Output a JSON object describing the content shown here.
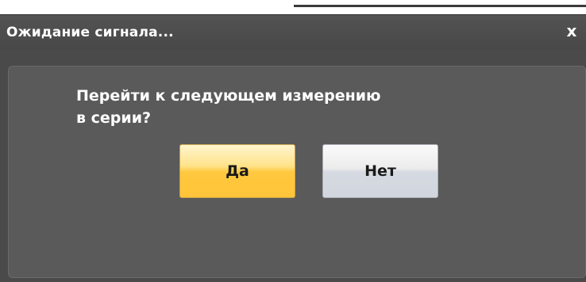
{
  "dialog": {
    "title": "Ожидание сигнала...",
    "close_label": "x",
    "message_line1": "Перейти к следующем измерению",
    "message_line2": "в серии?",
    "buttons": {
      "yes_label": "Да",
      "no_label": "Нет"
    }
  },
  "colors": {
    "dialog_bg": "#4a4a4a",
    "panel_bg": "#5a5a5a",
    "yes_button": "#ffc83e",
    "no_button": "#d5d9e0",
    "text": "#ffffff"
  },
  "icons": {
    "close": "close-icon"
  }
}
